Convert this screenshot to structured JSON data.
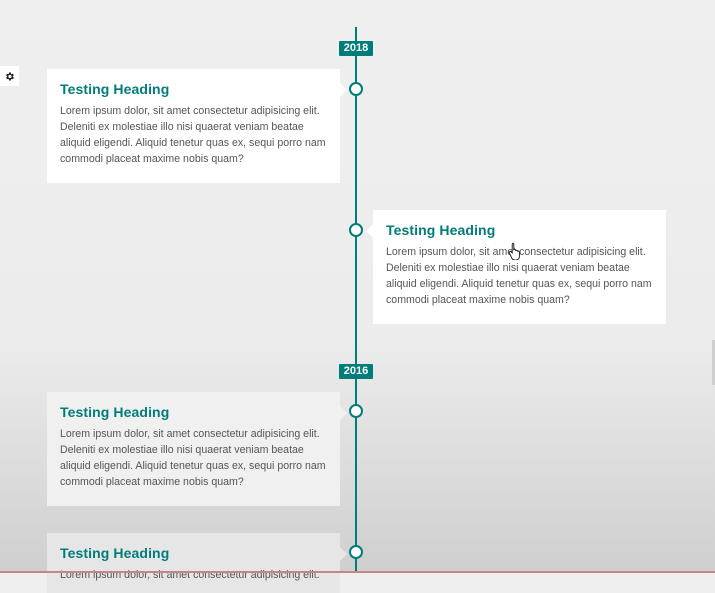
{
  "timeline": {
    "years": [
      {
        "label": "2018"
      },
      {
        "label": "2016"
      }
    ],
    "entries": [
      {
        "heading": "Testing Heading",
        "body": "Lorem ipsum dolor, sit amet consectetur adipisicing elit. Deleniti ex molestiae illo nisi quaerat veniam beatae aliquid eligendi. Aliquid tenetur quas ex, sequi porro nam commodi placeat maxime nobis quam?",
        "side": "left"
      },
      {
        "heading": "Testing Heading",
        "body": "Lorem ipsum dolor, sit amet consectetur adipisicing elit. Deleniti ex molestiae illo nisi quaerat veniam beatae aliquid eligendi. Aliquid tenetur quas ex, sequi porro nam commodi placeat maxime nobis quam?",
        "side": "right"
      },
      {
        "heading": "Testing Heading",
        "body": "Lorem ipsum dolor, sit amet consectetur adipisicing elit. Deleniti ex molestiae illo nisi quaerat veniam beatae aliquid eligendi. Aliquid tenetur quas ex, sequi porro nam commodi placeat maxime nobis quam?",
        "side": "left"
      },
      {
        "heading": "Testing Heading",
        "body": "Lorem ipsum dolor, sit amet consectetur adipisicing elit.",
        "side": "left"
      }
    ]
  },
  "icons": {
    "settings": "gear-icon",
    "cursor": "hand-pointer-icon"
  },
  "colors": {
    "accent": "#007d7b",
    "card": "#ffffff",
    "body_text": "#555555",
    "background": "#efefef"
  }
}
